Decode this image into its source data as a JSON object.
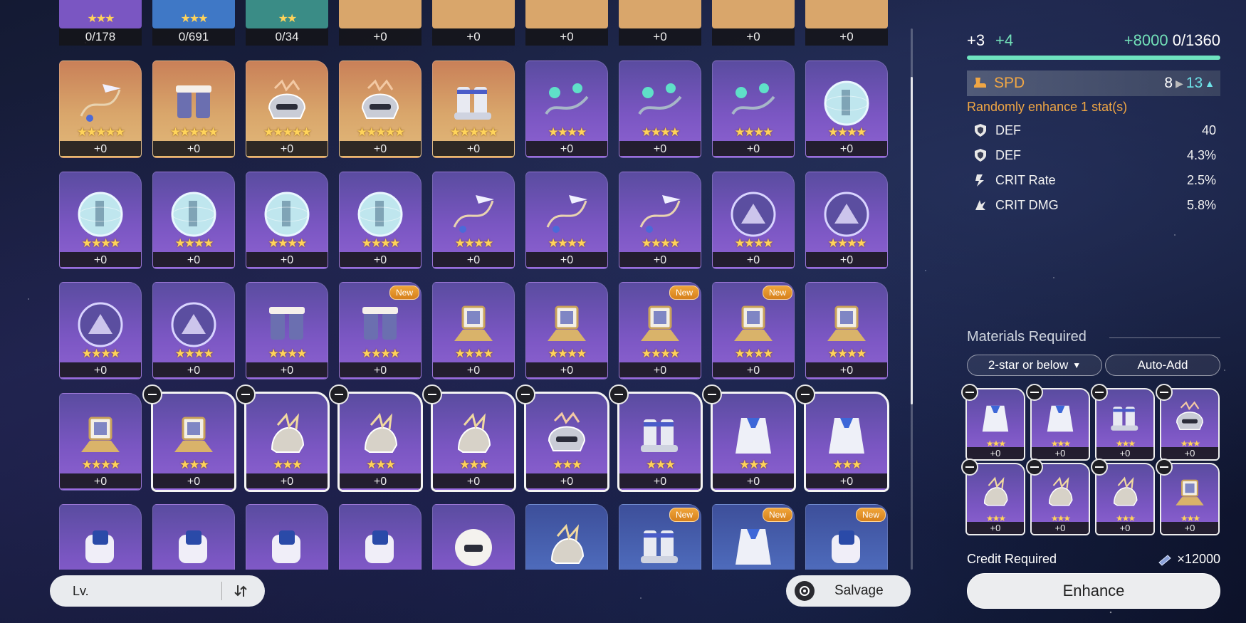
{
  "top_row": [
    {
      "rarity": "r4",
      "color": "#7a56c2",
      "stars": "★★★",
      "count": "0/178"
    },
    {
      "rarity": "r3",
      "color": "#3f78c6",
      "stars": "★★★",
      "count": "0/691"
    },
    {
      "rarity": "r2",
      "color": "#3a8c86",
      "stars": "★★",
      "count": "0/34"
    },
    {
      "rarity": "r5",
      "color": "#d9a66b",
      "stars": "",
      "count": "+0"
    },
    {
      "rarity": "r5",
      "color": "#d9a66b",
      "stars": "",
      "count": "+0"
    },
    {
      "rarity": "r5",
      "color": "#d9a66b",
      "stars": "",
      "count": "+0"
    },
    {
      "rarity": "r5",
      "color": "#d9a66b",
      "stars": "",
      "count": "+0"
    },
    {
      "rarity": "r5",
      "color": "#d9a66b",
      "stars": "",
      "count": "+0"
    },
    {
      "rarity": "r5",
      "color": "#d9a66b",
      "stars": "",
      "count": "+0"
    }
  ],
  "rows": [
    [
      {
        "r": "r5",
        "icon": "arrow-ribbon-relic-icon",
        "stars": "★★★★★",
        "lvl": "+0"
      },
      {
        "r": "r5",
        "icon": "gauntlet-relic-icon",
        "stars": "★★★★★",
        "lvl": "+0"
      },
      {
        "r": "r5",
        "icon": "helmet-relic-icon",
        "stars": "★★★★★",
        "lvl": "+0"
      },
      {
        "r": "r5",
        "icon": "helmet-relic-icon",
        "stars": "★★★★★",
        "lvl": "+0"
      },
      {
        "r": "r5",
        "icon": "boots-relic-icon",
        "stars": "★★★★★",
        "lvl": "+0"
      },
      {
        "r": "r4",
        "icon": "chain-relic-icon",
        "stars": "★★★★",
        "lvl": "+0"
      },
      {
        "r": "r4",
        "icon": "chain-relic-icon",
        "stars": "★★★★",
        "lvl": "+0"
      },
      {
        "r": "r4",
        "icon": "chain-relic-icon",
        "stars": "★★★★",
        "lvl": "+0"
      },
      {
        "r": "r4",
        "icon": "sphere-relic-icon",
        "stars": "★★★★",
        "lvl": "+0"
      }
    ],
    [
      {
        "r": "r4",
        "icon": "sphere-relic-icon",
        "stars": "★★★★",
        "lvl": "+0"
      },
      {
        "r": "r4",
        "icon": "sphere-relic-icon",
        "stars": "★★★★",
        "lvl": "+0"
      },
      {
        "r": "r4",
        "icon": "sphere-relic-icon",
        "stars": "★★★★",
        "lvl": "+0"
      },
      {
        "r": "r4",
        "icon": "sphere-relic-icon",
        "stars": "★★★★",
        "lvl": "+0"
      },
      {
        "r": "r4",
        "icon": "arrow-ribbon-relic-icon",
        "stars": "★★★★",
        "lvl": "+0"
      },
      {
        "r": "r4",
        "icon": "arrow-ribbon-relic-icon",
        "stars": "★★★★",
        "lvl": "+0"
      },
      {
        "r": "r4",
        "icon": "arrow-ribbon-relic-icon",
        "stars": "★★★★",
        "lvl": "+0"
      },
      {
        "r": "r4",
        "icon": "purple-sphere-relic-icon",
        "stars": "★★★★",
        "lvl": "+0"
      },
      {
        "r": "r4",
        "icon": "purple-sphere-relic-icon",
        "stars": "★★★★",
        "lvl": "+0"
      }
    ],
    [
      {
        "r": "r4",
        "icon": "purple-sphere-relic-icon",
        "stars": "★★★★",
        "lvl": "+0"
      },
      {
        "r": "r4",
        "icon": "purple-sphere-relic-icon",
        "stars": "★★★★",
        "lvl": "+0"
      },
      {
        "r": "r4",
        "icon": "gauntlet-relic-icon",
        "stars": "★★★★",
        "lvl": "+0"
      },
      {
        "r": "r4",
        "icon": "gauntlet-relic-icon",
        "stars": "★★★★",
        "lvl": "+0",
        "new": true
      },
      {
        "r": "r4",
        "icon": "lantern-relic-icon",
        "stars": "★★★★",
        "lvl": "+0"
      },
      {
        "r": "r4",
        "icon": "lantern-relic-icon",
        "stars": "★★★★",
        "lvl": "+0"
      },
      {
        "r": "r4",
        "icon": "lantern-relic-icon",
        "stars": "★★★★",
        "lvl": "+0",
        "new": true
      },
      {
        "r": "r4",
        "icon": "lantern-relic-icon",
        "stars": "★★★★",
        "lvl": "+0",
        "new": true
      },
      {
        "r": "r4",
        "icon": "lantern-relic-icon",
        "stars": "★★★★",
        "lvl": "+0"
      }
    ],
    [
      {
        "r": "r4",
        "icon": "lantern-relic-icon",
        "stars": "★★★★",
        "lvl": "+0"
      },
      {
        "r": "r4",
        "icon": "lantern-relic-icon",
        "stars": "★★★",
        "lvl": "+0",
        "selected": true
      },
      {
        "r": "r4",
        "icon": "feather-helmet-relic-icon",
        "stars": "★★★",
        "lvl": "+0",
        "selected": true
      },
      {
        "r": "r4",
        "icon": "feather-helmet-relic-icon",
        "stars": "★★★",
        "lvl": "+0",
        "selected": true
      },
      {
        "r": "r4",
        "icon": "feather-helmet-relic-icon",
        "stars": "★★★",
        "lvl": "+0",
        "selected": true
      },
      {
        "r": "r4",
        "icon": "helmet-relic-icon",
        "stars": "★★★",
        "lvl": "+0",
        "selected": true
      },
      {
        "r": "r4",
        "icon": "boots-relic-icon",
        "stars": "★★★",
        "lvl": "+0",
        "selected": true
      },
      {
        "r": "r4",
        "icon": "cloak-relic-icon",
        "stars": "★★★",
        "lvl": "+0",
        "selected": true
      },
      {
        "r": "r4",
        "icon": "cloak-relic-icon",
        "stars": "★★★",
        "lvl": "+0",
        "selected": true
      }
    ],
    [
      {
        "r": "r4",
        "icon": "glove-relic-icon",
        "stars": "",
        "lvl": ""
      },
      {
        "r": "r4",
        "icon": "glove-relic-icon",
        "stars": "",
        "lvl": ""
      },
      {
        "r": "r4",
        "icon": "glove-relic-icon",
        "stars": "",
        "lvl": ""
      },
      {
        "r": "r4",
        "icon": "glove-relic-icon",
        "stars": "",
        "lvl": ""
      },
      {
        "r": "r4",
        "icon": "fur-helmet-relic-icon",
        "stars": "",
        "lvl": ""
      },
      {
        "r": "r3",
        "icon": "feather-helmet-relic-icon",
        "stars": "",
        "lvl": ""
      },
      {
        "r": "r3",
        "icon": "boots-relic-icon",
        "stars": "",
        "lvl": "",
        "new": true
      },
      {
        "r": "r3",
        "icon": "cloak-relic-icon",
        "stars": "",
        "lvl": "",
        "new": true
      },
      {
        "r": "r3",
        "icon": "glove-relic-icon",
        "stars": "",
        "lvl": "",
        "new": true
      }
    ]
  ],
  "new_label": "New",
  "sort": {
    "label": "Lv."
  },
  "salvage_label": "Salvage",
  "panel": {
    "level_current": "+3",
    "level_add": "+4",
    "exp_add": "+8000",
    "exp_value": "0/1360",
    "main_stat": {
      "name": "SPD",
      "from": "8",
      "to": "13"
    },
    "enhance_note": "Randomly enhance 1 stat(s)",
    "sub_stats": [
      {
        "name": "DEF",
        "value": "40",
        "icon": "shield-icon"
      },
      {
        "name": "DEF",
        "value": "4.3%",
        "icon": "shield-icon"
      },
      {
        "name": "CRIT Rate",
        "value": "2.5%",
        "icon": "crit-rate-icon"
      },
      {
        "name": "CRIT DMG",
        "value": "5.8%",
        "icon": "crit-dmg-icon"
      }
    ],
    "materials_title": "Materials Required",
    "filter_label": "2-star or below",
    "auto_add_label": "Auto-Add",
    "materials": [
      {
        "icon": "cloak-relic-icon",
        "stars": "★★★",
        "lvl": "+0"
      },
      {
        "icon": "cloak-relic-icon",
        "stars": "★★★",
        "lvl": "+0"
      },
      {
        "icon": "boots-relic-icon",
        "stars": "★★★",
        "lvl": "+0"
      },
      {
        "icon": "helmet-relic-icon",
        "stars": "★★★",
        "lvl": "+0"
      },
      {
        "icon": "feather-helmet-relic-icon",
        "stars": "★★★",
        "lvl": "+0"
      },
      {
        "icon": "feather-helmet-relic-icon",
        "stars": "★★★",
        "lvl": "+0"
      },
      {
        "icon": "feather-helmet-relic-icon",
        "stars": "★★★",
        "lvl": "+0"
      },
      {
        "icon": "lantern-relic-icon",
        "stars": "★★★",
        "lvl": "+0"
      }
    ],
    "credit_label": "Credit Required",
    "credit_value": "×12000",
    "enhance_label": "Enhance"
  },
  "colors": {
    "accent_teal": "#6ee3bf",
    "stat_orange": "#f0a644",
    "star_gold": "#ffd35a",
    "rarity5": "#d9a66b",
    "rarity4": "#7a56c2"
  }
}
